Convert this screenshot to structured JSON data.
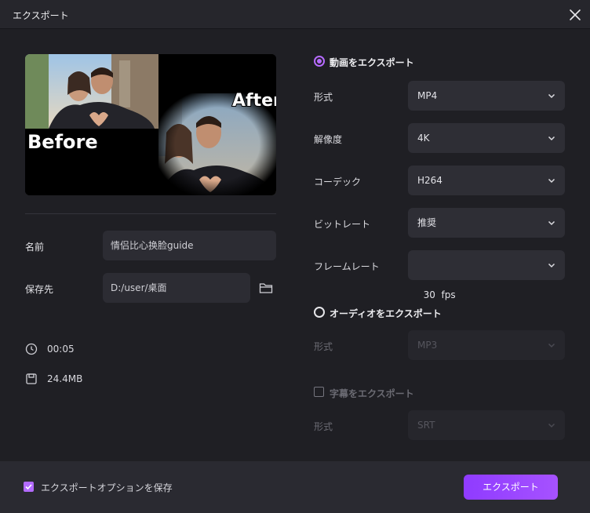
{
  "window": {
    "title": "エクスポート"
  },
  "preview": {
    "before_label": "Before",
    "after_label": "After"
  },
  "left": {
    "name_label": "名前",
    "name_value": "情侣比心换脸guide",
    "saveto_label": "保存先",
    "saveto_value": "D:/user/桌面",
    "duration": "00:05",
    "filesize": "24.4MB"
  },
  "video": {
    "heading": "動画をエクスポート",
    "rows": [
      {
        "label": "形式",
        "value": "MP4"
      },
      {
        "label": "解像度",
        "value": "4K"
      },
      {
        "label": "コーデック",
        "value": "H264"
      },
      {
        "label": "ビットレート",
        "value": "推奨"
      },
      {
        "label": "フレームレート",
        "value": "30  fps"
      }
    ]
  },
  "audio": {
    "heading": "オーディオをエクスポート",
    "format_label": "形式",
    "format_value": "MP3"
  },
  "subtitle": {
    "heading": "字幕をエクスポート",
    "format_label": "形式",
    "format_value": "SRT"
  },
  "footer": {
    "save_options_label": "エクスポートオプションを保存",
    "export_button": "エクスポート"
  },
  "colors": {
    "accent": "#a652ff",
    "background": "#1f1f24",
    "field": "#2e2e35"
  },
  "icons": [
    "close-icon",
    "folder-icon",
    "clock-icon",
    "file-size-icon",
    "chevron-down-icon",
    "checkmark-icon"
  ]
}
